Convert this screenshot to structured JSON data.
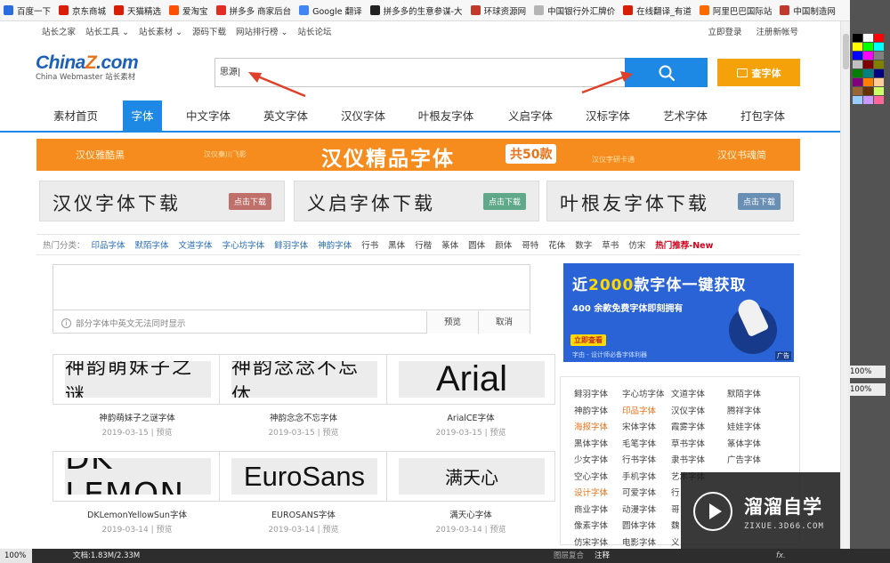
{
  "bookmarks": [
    {
      "label": "百度一下",
      "color": "#2b6de0"
    },
    {
      "label": "京东商城",
      "color": "#d81e06"
    },
    {
      "label": "天猫精选",
      "color": "#d81e06"
    },
    {
      "label": "爱淘宝",
      "color": "#ff5000"
    },
    {
      "label": "拼多多 商家后台",
      "color": "#e02e24"
    },
    {
      "label": "Google 翻译",
      "color": "#4285f4"
    },
    {
      "label": "拼多多的生意参谋-大",
      "color": "#222222"
    },
    {
      "label": "环球资源网",
      "color": "#c0392b"
    },
    {
      "label": "中国银行外汇牌价",
      "color": "#b5b5b5"
    },
    {
      "label": "在线翻译_有道",
      "color": "#d81e06"
    },
    {
      "label": "阿里巴巴国际站",
      "color": "#ff6a00"
    },
    {
      "label": "中国制造网",
      "color": "#c0392b"
    }
  ],
  "toplinks": {
    "left": [
      "站长之家",
      "站长工具 ⌄",
      "站长素材 ⌄",
      "源码下载",
      "网站排行榜 ⌄",
      "站长论坛"
    ],
    "right": [
      "立即登录",
      "注册新帐号"
    ]
  },
  "logo": {
    "brand_a": "China",
    "brand_z": "Z",
    "brand_b": ".com",
    "sub": "China Webmaster 站长素材"
  },
  "search": {
    "value": "思源|",
    "find_label": "查字体"
  },
  "nav": [
    {
      "label": "素材首页",
      "active": false
    },
    {
      "label": "字体",
      "active": true
    },
    {
      "label": "中文字体",
      "active": false
    },
    {
      "label": "英文字体",
      "active": false
    },
    {
      "label": "汉仪字体",
      "active": false
    },
    {
      "label": "叶根友字体",
      "active": false
    },
    {
      "label": "义启字体",
      "active": false
    },
    {
      "label": "汉标字体",
      "active": false
    },
    {
      "label": "艺术字体",
      "active": false
    },
    {
      "label": "打包字体",
      "active": false
    }
  ],
  "banner": {
    "left": "汉仪雅酷黑",
    "left_small": "汉仪秦川飞影",
    "title": "汉仪精品字体",
    "badge": "共50款",
    "right_small": "汉仪字研卡通",
    "right": "汉仪书魂简"
  },
  "font_banners": [
    {
      "title": "汉仪字体下载",
      "button": "点击下载",
      "button_color": "#c0706a"
    },
    {
      "title": "义启字体下载",
      "button": "点击下载",
      "button_color": "#5fa88a"
    },
    {
      "title": "叶根友字体下载",
      "button": "点击下载",
      "button_color": "#6a8fb5"
    }
  ],
  "hot": {
    "label": "热门分类：",
    "items": [
      {
        "label": "印品字体",
        "style": "blue"
      },
      {
        "label": "默陌字体",
        "style": "blue"
      },
      {
        "label": "文道字体",
        "style": "blue"
      },
      {
        "label": "字心坊字体",
        "style": "blue"
      },
      {
        "label": "鲱羽字体",
        "style": "blue"
      },
      {
        "label": "神韵字体",
        "style": "blue"
      },
      {
        "label": "行书",
        "style": "gray"
      },
      {
        "label": "黑体",
        "style": "gray"
      },
      {
        "label": "行楷",
        "style": "gray"
      },
      {
        "label": "篆体",
        "style": "gray"
      },
      {
        "label": "圆体",
        "style": "gray"
      },
      {
        "label": "颜体",
        "style": "gray"
      },
      {
        "label": "哥特",
        "style": "gray"
      },
      {
        "label": "花体",
        "style": "gray"
      },
      {
        "label": "数字",
        "style": "gray"
      },
      {
        "label": "草书",
        "style": "gray"
      },
      {
        "label": "仿宋",
        "style": "gray"
      },
      {
        "label": "热门推荐-New",
        "style": "red"
      }
    ]
  },
  "preview": {
    "note": "部分字体中英文无法同时显示",
    "info_icon": "i",
    "preview_btn": "预览",
    "cancel_btn": "取消"
  },
  "fonts": [
    {
      "sample": "神韵萌妹子之谜",
      "name": "神韵萌妹子之谜字体",
      "date": "2019-03-15",
      "action": "预览"
    },
    {
      "sample": "神韵念念不忘体",
      "name": "神韵念念不忘字体",
      "date": "2019-03-15",
      "action": "预览"
    },
    {
      "sample": "Arial",
      "name": "ArialCE字体",
      "date": "2019-03-15",
      "action": "预览"
    },
    {
      "sample": "DK LEMON",
      "name": "DKLemonYellowSun字体",
      "date": "2019-03-14",
      "action": "预览"
    },
    {
      "sample": "EuroSans",
      "name": "EUROSANS字体",
      "date": "2019-03-14",
      "action": "预览"
    },
    {
      "sample": "满天心",
      "name": "满天心字体",
      "date": "2019-03-14",
      "action": "预览"
    }
  ],
  "ad": {
    "line1_a": "近",
    "line1_num": "2000",
    "line1_b": "款字体一键获取",
    "line2": "400 余款免费字体即刻拥有",
    "cta": "立即查看",
    "small": "字由 - 设计师必备字体利器",
    "tag": "广告"
  },
  "tags": [
    {
      "label": "鲱羽字体",
      "style": "gray"
    },
    {
      "label": "字心坊字体",
      "style": "gray"
    },
    {
      "label": "文道字体",
      "style": "gray"
    },
    {
      "label": "默陌字体",
      "style": "gray"
    },
    {
      "label": "神韵字体",
      "style": "gray"
    },
    {
      "label": "印品字体",
      "style": "orange"
    },
    {
      "label": "汉仪字体",
      "style": "gray"
    },
    {
      "label": "腾祥字体",
      "style": "gray"
    },
    {
      "label": "海报字体",
      "style": "orange"
    },
    {
      "label": "宋体字体",
      "style": "gray"
    },
    {
      "label": "霞雾字体",
      "style": "gray"
    },
    {
      "label": "娃娃字体",
      "style": "gray"
    },
    {
      "label": "黑体字体",
      "style": "gray"
    },
    {
      "label": "毛笔字体",
      "style": "gray"
    },
    {
      "label": "草书字体",
      "style": "gray"
    },
    {
      "label": "篆体字体",
      "style": "gray"
    },
    {
      "label": "少女字体",
      "style": "gray"
    },
    {
      "label": "行书字体",
      "style": "gray"
    },
    {
      "label": "隶书字体",
      "style": "gray"
    },
    {
      "label": "广告字体",
      "style": "gray"
    },
    {
      "label": "空心字体",
      "style": "gray"
    },
    {
      "label": "手机字体",
      "style": "gray"
    },
    {
      "label": "艺术字体",
      "style": "gray"
    },
    {
      "label": "",
      "style": "gray"
    },
    {
      "label": "设计字体",
      "style": "orange"
    },
    {
      "label": "可爱字体",
      "style": "gray"
    },
    {
      "label": "行",
      "style": "gray"
    },
    {
      "label": "",
      "style": "gray"
    },
    {
      "label": "商业字体",
      "style": "gray"
    },
    {
      "label": "动漫字体",
      "style": "gray"
    },
    {
      "label": "哥",
      "style": "gray"
    },
    {
      "label": "",
      "style": "gray"
    },
    {
      "label": "像素字体",
      "style": "gray"
    },
    {
      "label": "圆体字体",
      "style": "gray"
    },
    {
      "label": "魏",
      "style": "gray"
    },
    {
      "label": "",
      "style": "gray"
    },
    {
      "label": "仿宋字体",
      "style": "gray"
    },
    {
      "label": "电影字体",
      "style": "gray"
    },
    {
      "label": "义",
      "style": "gray"
    },
    {
      "label": "",
      "style": "gray"
    }
  ],
  "watermark": {
    "title": "溜溜自学",
    "url": "ZIXUE.3D66.COM"
  },
  "ps": {
    "zoom": "100%",
    "doc": "文档:1.83M/2.33M",
    "tab1": "图层复合",
    "tab2": "注释",
    "fx": "fx.",
    "opacity1": "100%",
    "opacity2": "100%",
    "swatches": [
      "#000000",
      "#ffffff",
      "#ff0000",
      "#ffff00",
      "#00ff00",
      "#00ffff",
      "#0000ff",
      "#ff00ff",
      "#808080",
      "#c0c0c0",
      "#800000",
      "#808000",
      "#008000",
      "#008080",
      "#000080",
      "#800080",
      "#ff8000",
      "#ffcc99",
      "#996633",
      "#663300",
      "#ccff66",
      "#99ccff",
      "#cc99ff",
      "#ff6699"
    ]
  }
}
